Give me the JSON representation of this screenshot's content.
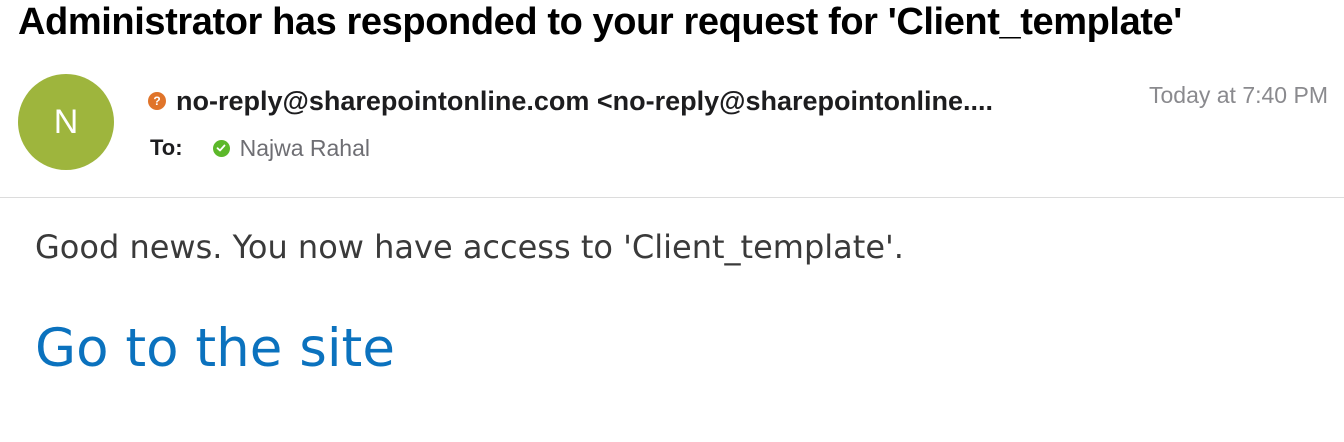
{
  "subject": "Administrator has responded to your request for 'Client_template'",
  "sender": {
    "avatar_initial": "N",
    "avatar_color": "#9eb53d",
    "status_icon": "question-icon",
    "status_color": "#e0742a",
    "display": "no-reply@sharepointonline.com <no-reply@sharepointonline...."
  },
  "recipients": {
    "label": "To:",
    "status_icon": "checkmark-icon",
    "status_color": "#5cb82a",
    "name": "Najwa Rahal"
  },
  "date": "Today at 7:40 PM",
  "body": {
    "message": "Good news. You now have access to 'Client_template'.",
    "link_label": "Go to the site",
    "link_color": "#0b72be"
  }
}
